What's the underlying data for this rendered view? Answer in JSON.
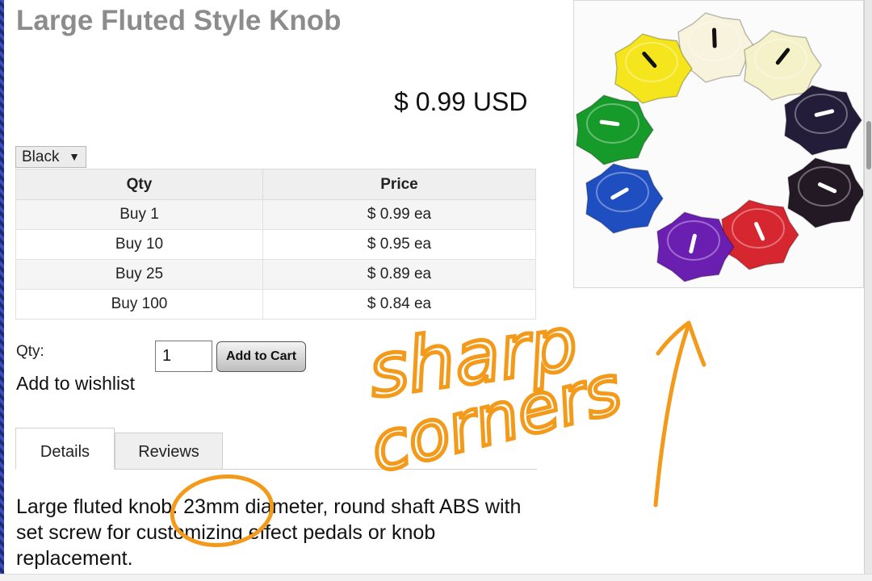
{
  "product": {
    "title": "Large Fluted Style Knob",
    "price": "$ 0.99 USD",
    "variant": {
      "selected": "Black",
      "arrow": "▼"
    },
    "tiers": {
      "headers": [
        "Qty",
        "Price"
      ],
      "rows": [
        [
          "Buy 1",
          "$ 0.99 ea"
        ],
        [
          "Buy 10",
          "$ 0.95 ea"
        ],
        [
          "Buy 25",
          "$ 0.89 ea"
        ],
        [
          "Buy 100",
          "$ 0.84 ea"
        ]
      ]
    },
    "qty_label": "Qty:",
    "qty_value": "1",
    "add_to_cart": "Add to Cart",
    "wishlist": "Add to wishlist",
    "tabs": [
      "Details",
      "Reviews"
    ],
    "description": "Large fluted knob. 23mm diameter, round shaft ABS with set screw for customizing effect pedals or knob replacement."
  },
  "image": {
    "knob_colors": [
      "#f7f3dc",
      "#f5f1c9",
      "#231d3a",
      "#221925",
      "#d6262f",
      "#6a1fb1",
      "#1f4ec1",
      "#169a2a",
      "#f4e51c"
    ]
  },
  "annotation": {
    "text_line1": "sharp",
    "text_line2": "corners",
    "color": "#f39a1a"
  }
}
